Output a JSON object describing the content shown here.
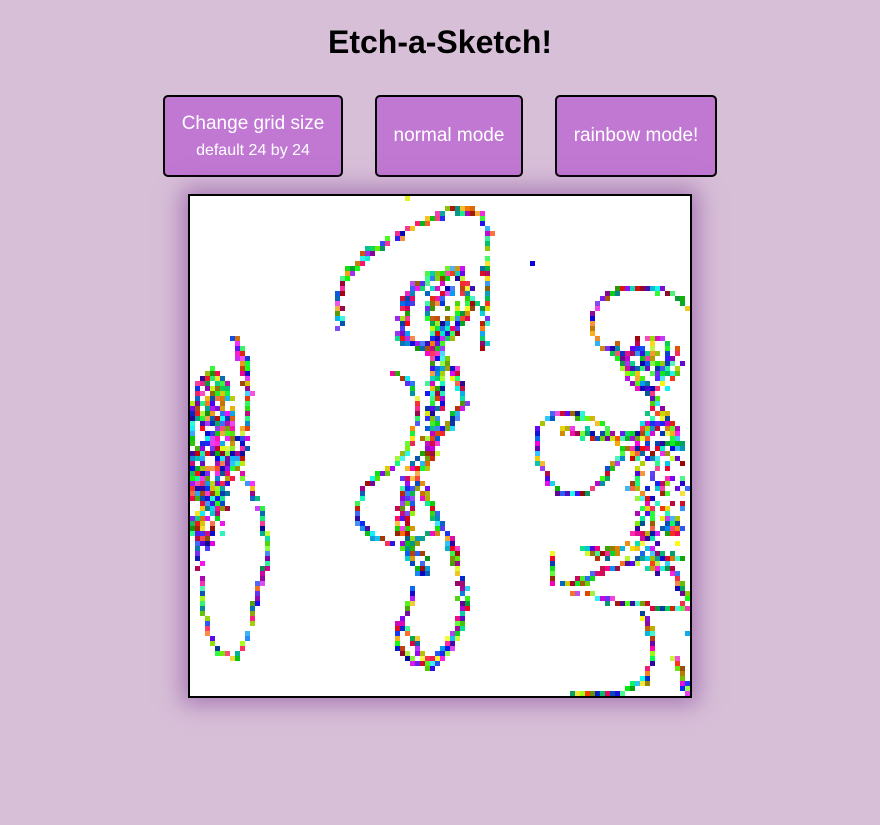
{
  "header": {
    "title": "Etch-a-Sketch!"
  },
  "controls": {
    "grid_size_label": "Change grid size",
    "grid_size_hint": "default 24 by 24",
    "normal_mode_label": "normal mode",
    "rainbow_mode_label": "rainbow mode!"
  },
  "colors": {
    "background": "#d8bfd8",
    "button": "#c178d3",
    "canvas": "#ffffff"
  },
  "canvas": {
    "cells_per_side": 100
  }
}
